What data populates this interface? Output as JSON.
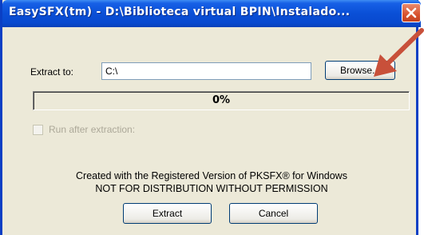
{
  "window": {
    "title": "EasySFX(tm) - D:\\Biblioteca virtual BPIN\\Instalado...",
    "close_icon": "close-icon"
  },
  "extract": {
    "label": "Extract to:",
    "value": "C:\\",
    "browse_label": "Browse..."
  },
  "progress": {
    "text": "0%",
    "value": 0
  },
  "run_after": {
    "label": "Run after extraction:",
    "checked": false,
    "enabled": false
  },
  "info": {
    "line1": "Created with the Registered Version of PKSFX® for Windows",
    "line2": "NOT FOR DISTRIBUTION WITHOUT PERMISSION"
  },
  "buttons": {
    "extract_label": "Extract",
    "cancel_label": "Cancel"
  },
  "annotation": {
    "arrow_color": "#c8503a"
  }
}
